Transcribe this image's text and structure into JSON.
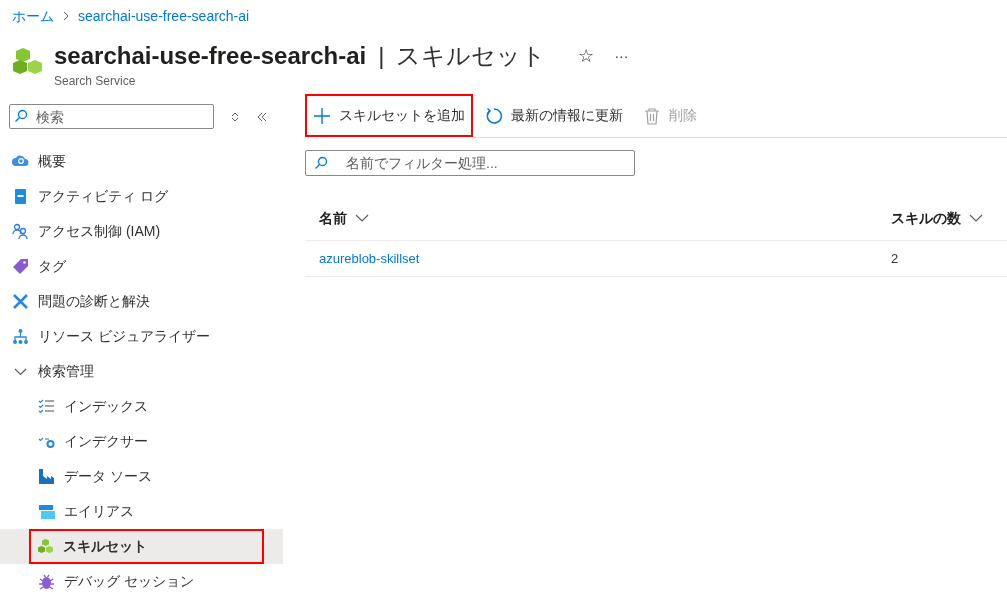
{
  "breadcrumb": [
    {
      "label": "ホーム"
    },
    {
      "label": "searchai-use-free-search-ai"
    }
  ],
  "header": {
    "title": "searchai-use-free-search-ai",
    "separator": "|",
    "section": "スキルセット",
    "subtitle": "Search Service",
    "favorite": "☆",
    "more": "···"
  },
  "sidebar": {
    "search": {
      "placeholder": "検索"
    },
    "items": [
      {
        "label": "概要",
        "selected": false,
        "highlighted": false
      },
      {
        "label": "アクティビティ ログ",
        "selected": false,
        "highlighted": false
      },
      {
        "label": "アクセス制御 (IAM)",
        "selected": false,
        "highlighted": false
      },
      {
        "label": "タグ",
        "selected": false,
        "highlighted": false
      },
      {
        "label": "問題の診断と解決",
        "selected": false,
        "highlighted": false
      },
      {
        "label": "リソース ビジュアライザー",
        "selected": false,
        "highlighted": false
      },
      {
        "label": "検索管理",
        "expanded": true,
        "children": [
          {
            "label": "インデックス",
            "selected": false,
            "highlighted": false
          },
          {
            "label": "インデクサー",
            "selected": false,
            "highlighted": false
          },
          {
            "label": "データ ソース",
            "selected": false,
            "highlighted": false
          },
          {
            "label": "エイリアス",
            "selected": false,
            "highlighted": false
          },
          {
            "label": "スキルセット",
            "selected": true,
            "highlighted": true
          },
          {
            "label": "デバッグ セッション",
            "selected": false,
            "highlighted": false
          }
        ]
      }
    ]
  },
  "toolbar": [
    {
      "kind": "add",
      "label": "スキルセットを追加",
      "disabled": false,
      "highlighted": true
    },
    {
      "kind": "refresh",
      "label": "最新の情報に更新",
      "disabled": false,
      "highlighted": false
    },
    {
      "kind": "delete",
      "label": "削除",
      "disabled": true,
      "highlighted": false
    }
  ],
  "filter": {
    "placeholder": "名前でフィルター処理..."
  },
  "table": {
    "columns": [
      "名前",
      "スキルの数"
    ],
    "rows": [
      [
        "azureblob-skillset",
        "2"
      ]
    ]
  }
}
